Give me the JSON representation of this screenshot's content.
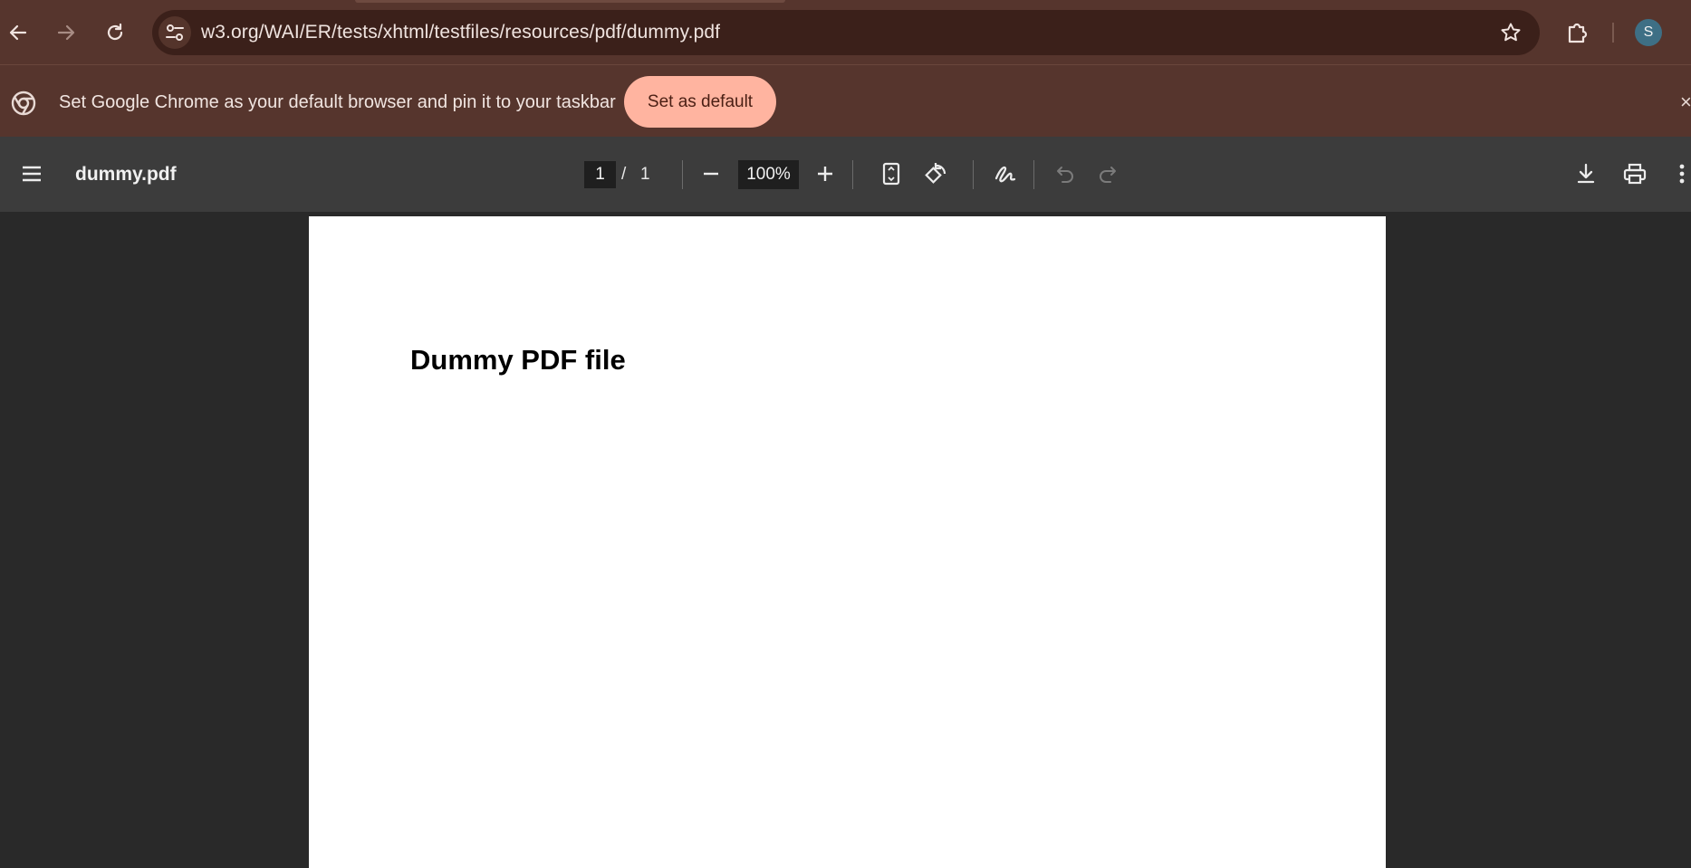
{
  "browser": {
    "url": "w3.org/WAI/ER/tests/xhtml/testfiles/resources/pdf/dummy.pdf",
    "profile_initial": "S",
    "icons": {
      "back": "arrow-left-icon",
      "forward": "arrow-right-icon",
      "reload": "reload-icon",
      "site_info": "tune-icon",
      "bookmark": "star-icon",
      "extensions": "puzzle-icon"
    }
  },
  "infobar": {
    "message": "Set Google Chrome as your default browser and pin it to your taskbar",
    "button_label": "Set as default",
    "close_symbol": "×",
    "icon": "chrome-logo-icon"
  },
  "pdf_toolbar": {
    "title": "dummy.pdf",
    "current_page": "1",
    "separator": "/",
    "total_pages": "1",
    "zoom": "100%",
    "icons": [
      "menu-icon",
      "zoom-out-icon",
      "zoom-in-icon",
      "fit-page-icon",
      "rotate-icon",
      "annotate-icon",
      "undo-icon",
      "redo-icon",
      "download-icon",
      "print-icon",
      "more-icon"
    ]
  },
  "document": {
    "heading": "Dummy PDF file"
  },
  "colors": {
    "chrome_bg": "#56352d",
    "omnibox_bg": "#3b201a",
    "accent_button": "#ffb4a0",
    "pdf_toolbar_bg": "#3c3c3c",
    "viewer_bg": "#292929"
  }
}
